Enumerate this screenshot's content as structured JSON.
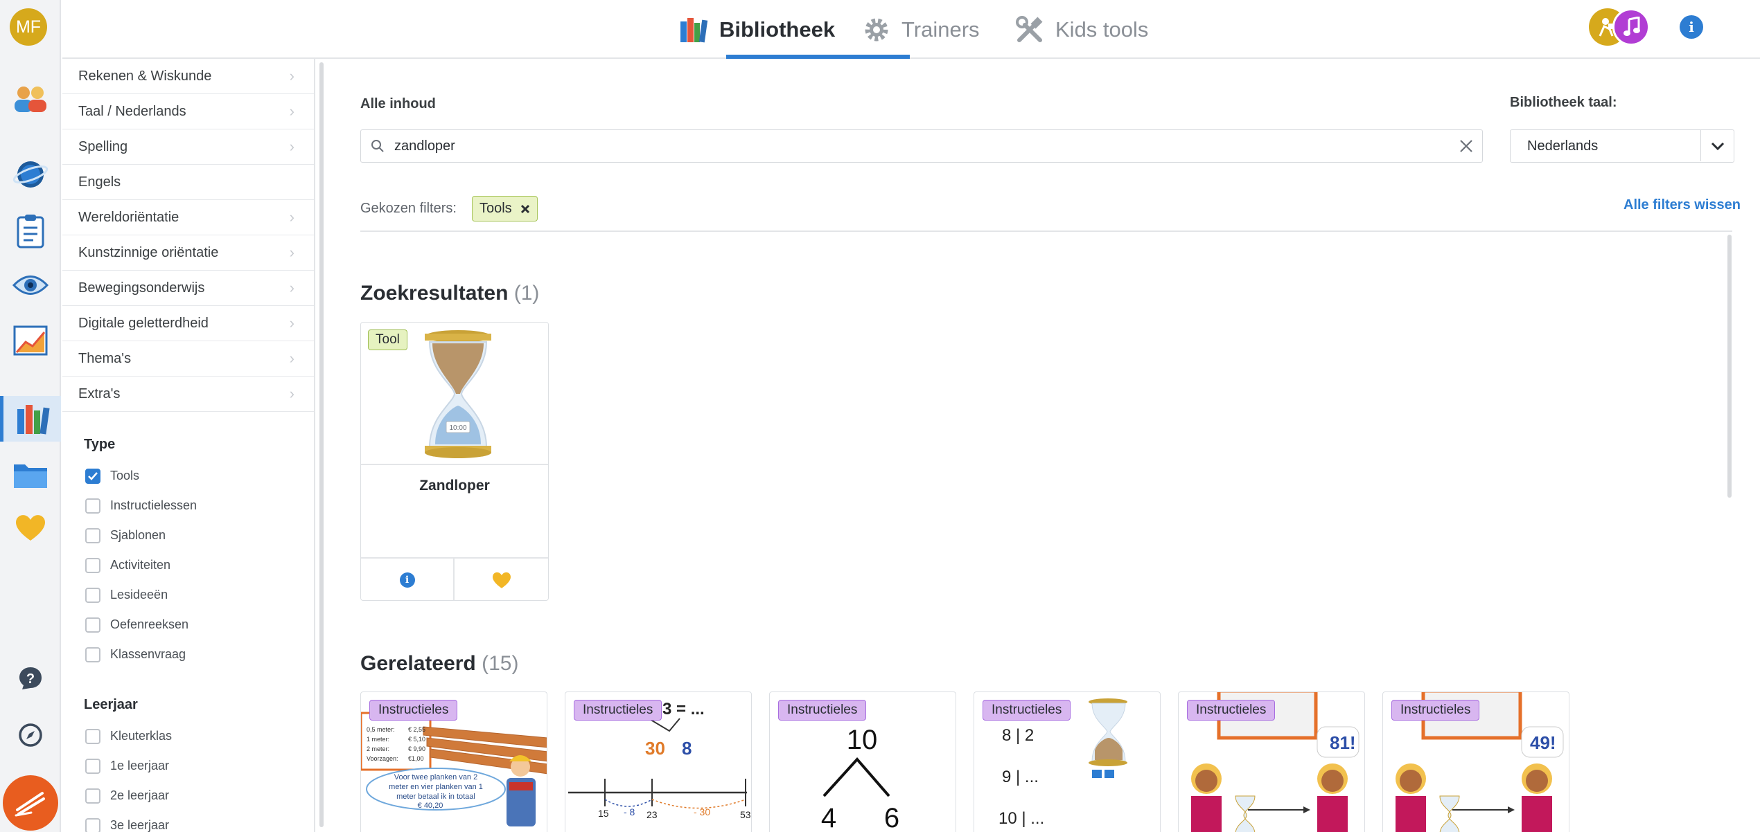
{
  "user": {
    "initials": "MF"
  },
  "topnav": {
    "tabs": [
      {
        "label": "Bibliotheek",
        "icon": "books-icon"
      },
      {
        "label": "Trainers",
        "icon": "gear-icon"
      },
      {
        "label": "Kids tools",
        "icon": "tools-icon"
      }
    ]
  },
  "categories": [
    {
      "label": "Rekenen & Wiskunde"
    },
    {
      "label": "Taal / Nederlands"
    },
    {
      "label": "Spelling"
    },
    {
      "label": "Engels"
    },
    {
      "label": "Wereldoriëntatie"
    },
    {
      "label": "Kunstzinnige oriëntatie"
    },
    {
      "label": "Bewegingsonderwijs"
    },
    {
      "label": "Digitale geletterdheid"
    },
    {
      "label": "Thema's"
    },
    {
      "label": "Extra's"
    }
  ],
  "filters": {
    "type": {
      "title": "Type",
      "options": [
        {
          "label": "Tools",
          "checked": true
        },
        {
          "label": "Instructielessen",
          "checked": false
        },
        {
          "label": "Sjablonen",
          "checked": false
        },
        {
          "label": "Activiteiten",
          "checked": false
        },
        {
          "label": "Lesideeën",
          "checked": false
        },
        {
          "label": "Oefenreeksen",
          "checked": false
        },
        {
          "label": "Klassenvraag",
          "checked": false
        }
      ]
    },
    "leerjaar": {
      "title": "Leerjaar",
      "options": [
        {
          "label": "Kleuterklas",
          "checked": false
        },
        {
          "label": "1e leerjaar",
          "checked": false
        },
        {
          "label": "2e leerjaar",
          "checked": false
        },
        {
          "label": "3e leerjaar",
          "checked": false
        }
      ]
    }
  },
  "content": {
    "all_label": "Alle inhoud",
    "search_value": "zandloper",
    "lang_label": "Bibliotheek taal:",
    "lang_value": "Nederlands",
    "chosen_label": "Gekozen filters:",
    "chosen_chip": "Tools",
    "clear_all": "Alle filters wissen"
  },
  "results": {
    "title": "Zoekresultaten",
    "count": "(1)",
    "items": [
      {
        "badge": "Tool",
        "title": "Zandloper",
        "time": "10:00"
      }
    ]
  },
  "related": {
    "title": "Gerelateerd",
    "count": "(15)",
    "items": [
      {
        "badge": "Instructieles",
        "texts": [
          "0,5 meter:",
          "€ 2,55",
          "1 meter:",
          "€ 5,10",
          "2 meter:",
          "€ 9,90",
          "Voorzagen:",
          "€1,00",
          "Voor twee planken van 2",
          "meter en vier planken van 1",
          "meter betaal ik in totaal",
          "€ 40,20"
        ]
      },
      {
        "badge": "Instructieles",
        "texts": [
          "3 = ...",
          "30",
          "8",
          "15",
          "- 8",
          "23",
          "- 30",
          "53"
        ]
      },
      {
        "badge": "Instructieles",
        "texts": [
          "10",
          "4",
          "6"
        ]
      },
      {
        "badge": "Instructieles",
        "texts": [
          "8 | 2",
          "9 | ...",
          "10 | ..."
        ]
      },
      {
        "badge": "Instructieles",
        "texts": [
          "81!"
        ]
      },
      {
        "badge": "Instructieles",
        "texts": [
          "49!"
        ]
      }
    ]
  }
}
